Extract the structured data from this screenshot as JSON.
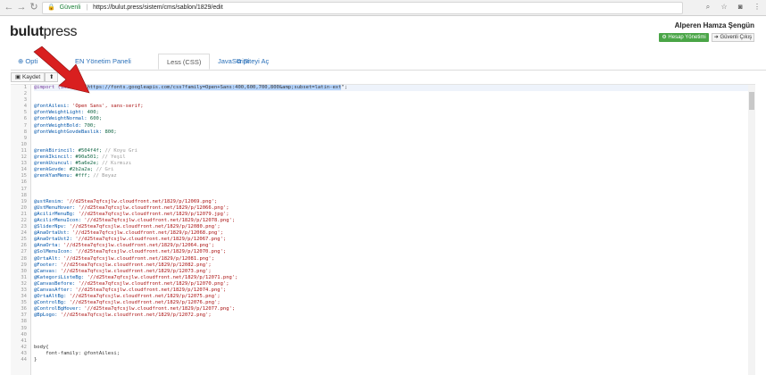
{
  "browser": {
    "secure_label": "Güvenli",
    "url": "https://bulut.press/sistem/cms/sablon/1829/edit"
  },
  "header": {
    "logo_prefix": "bulut",
    "logo_suffix": "press",
    "user_name": "Alperen Hamza Şengün",
    "account_button": "Hesap Yönetimi",
    "logout_button": "Güvenli Çıkış"
  },
  "tabs": [
    {
      "label": "Opti"
    },
    {
      "label": "EN Yönetim Paneli"
    },
    {
      "label": "Less (CSS)"
    },
    {
      "label": "JavaScript"
    },
    {
      "label": "Siteyi Aç"
    }
  ],
  "toolbar": {
    "save": "Kaydet"
  },
  "editor": {
    "lines": [
      "@import (inline) \"https://fonts.googleapis.com/css?family=Open+Sans:400,600,700,800&amp;subset=latin-ext\";",
      "",
      "",
      "@fontAilesi: 'Open Sans', sans-serif;",
      "@fontWeightLight: 400;",
      "@fontWeightNormal: 600;",
      "@fontWeightBold: 700;",
      "@fontWeightGovdeBaslik: 800;",
      "",
      "",
      "@renkBirincil: #504f4f; // Koyu Gri",
      "@renkIkincil: #90a501; // Yeşil",
      "@renkUcuncul: #5a6e2e; // Kırmızı",
      "@renkGovde: #2b2a2a; // Gri",
      "@renkYanMenu: #fff; // Beyaz",
      "",
      "",
      "",
      "@ustResim: '//d25tea7qfcsjlw.cloudfront.net/1829/p/12069.png';",
      "@UstMenuHover: '//d25tea7qfcsjlw.cloudfront.net/1829/p/12066.png';",
      "@AcilirMenuBg: '//d25tea7qfcsjlw.cloudfront.net/1829/p/12079.jpg';",
      "@AcilirMenuIcon: '//d25tea7qfcsjlw.cloudfront.net/1829/p/12078.png';",
      "@SliderNpv: '//d25tea7qfcsjlw.cloudfront.net/1829/p/12080.png';",
      "@AnaOrtaUst: '//d25tea7qfcsjlw.cloudfront.net/1829/p/12068.png';",
      "@AnaOrtaUst2: '//d25tea7qfcsjlw.cloudfront.net/1829/p/12067.png';",
      "@AnaOrta: '//d25tea7qfcsjlw.cloudfront.net/1829/p/12064.png';",
      "@SolMenuIcon: '//d25tea7qfcsjlw.cloudfront.net/1829/p/12070.png';",
      "@OrtaAlt: '//d25tea7qfcsjlw.cloudfront.net/1829/p/12081.png';",
      "@Footer: '//d25tea7qfcsjlw.cloudfront.net/1829/p/12082.png';",
      "@Canvas: '//d25tea7qfcsjlw.cloudfront.net/1829/p/12073.png';",
      "@KategoriListeBg: '//d25tea7qfcsjlw.cloudfront.net/1829/p/12071.png';",
      "@CanvasBefore: '//d25tea7qfcsjlw.cloudfront.net/1829/p/12070.png';",
      "@CanvasAfter: '//d25tea7qfcsjlw.cloudfront.net/1829/p/12074.png';",
      "@OrtaAltBg: '//d25tea7qfcsjlw.cloudfront.net/1829/p/12075.png';",
      "@ControlBg: '//d25tea7qfcsjlw.cloudfront.net/1829/p/12076.png';",
      "@ControlBgHover: '//d25tea7qfcsjlw.cloudfront.net/1829/p/12077.png';",
      "@BpLogo: '//d25tea7qfcsjlw.cloudfront.net/1829/p/12072.png';",
      "",
      "",
      "",
      "",
      "body{",
      "    font-family: @fontAilesi;",
      "}"
    ]
  },
  "colors": {
    "accent_blue": "#2a70b9",
    "success_green": "#4aa547",
    "arrow_red": "#d91f1f"
  }
}
